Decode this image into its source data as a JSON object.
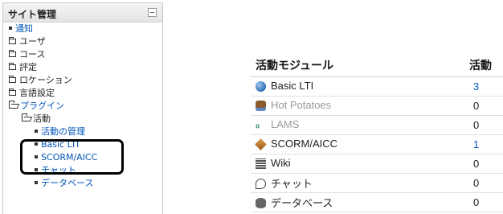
{
  "sidebar": {
    "title": "サイト管理",
    "items": [
      {
        "label": "通知",
        "icon": "bullet-icon"
      },
      {
        "label": "ユーザ",
        "icon": "folder-icon"
      },
      {
        "label": "コース",
        "icon": "folder-icon"
      },
      {
        "label": "評定",
        "icon": "folder-icon"
      },
      {
        "label": "ロケーション",
        "icon": "folder-icon"
      },
      {
        "label": "言語設定",
        "icon": "folder-icon"
      },
      {
        "label": "プラグイン",
        "icon": "folder-open-icon"
      },
      {
        "label": "活動",
        "icon": "folder-open-icon"
      },
      {
        "label": "活動の管理",
        "icon": "bullet-icon"
      },
      {
        "label": "Basic LTI",
        "icon": "bullet-icon"
      },
      {
        "label": "SCORM/AICC",
        "icon": "bullet-icon"
      },
      {
        "label": "チャット",
        "icon": "bullet-icon"
      },
      {
        "label": "データベース",
        "icon": "bullet-icon"
      }
    ]
  },
  "table": {
    "header_module": "活動モジュール",
    "header_count": "活動",
    "rows": [
      {
        "name": "Basic LTI",
        "count": "3",
        "icon": "globe-icon"
      },
      {
        "name": "Hot Potatoes",
        "count": "0",
        "icon": "hot-potatoes-icon"
      },
      {
        "name": "LAMS",
        "count": "0",
        "icon": "lams-icon"
      },
      {
        "name": "SCORM/AICC",
        "count": "1",
        "icon": "scorm-package-icon"
      },
      {
        "name": "Wiki",
        "count": "0",
        "icon": "wiki-icon"
      },
      {
        "name": "チャット",
        "count": "0",
        "icon": "chat-icon"
      },
      {
        "name": "データベース",
        "count": "0",
        "icon": "database-icon"
      }
    ]
  },
  "colors": {
    "link": "#0055bb",
    "disabled": "#9a9a9a",
    "annotation": "#000000"
  }
}
